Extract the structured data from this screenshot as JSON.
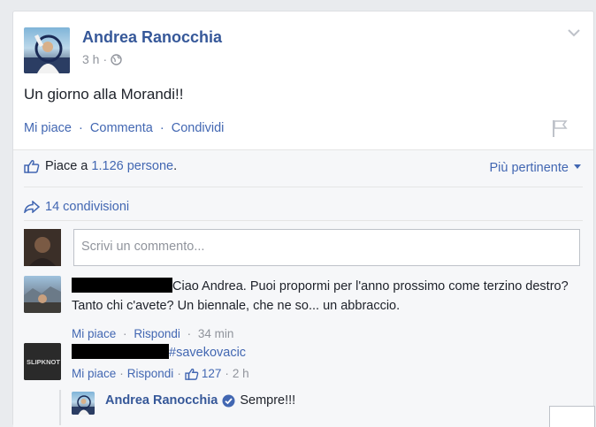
{
  "post": {
    "author": "Andrea Ranocchia",
    "time": "3 h",
    "time_sep": "·",
    "status_text": "Un giorno alla Morandi!!",
    "actions": {
      "like": "Mi piace",
      "comment": "Commenta",
      "share": "Condividi",
      "sep": "·"
    }
  },
  "ufi": {
    "likes_prefix": "Piace a",
    "likes_count": "1.126 persone",
    "likes_suffix": ".",
    "sort_label": "Più pertinente",
    "shares_label": "14 condivisioni",
    "comment_placeholder": "Scrivi un commento...",
    "colors": {
      "link": "#4267b2",
      "name": "#365899",
      "muted": "#90949c",
      "background": "#f6f7f9"
    }
  },
  "comments": [
    {
      "text": "Ciao Andrea. Puoi propormi per l'anno prossimo come terzino destro? Tanto chi c'avete? Un biennale, che ne so... un abbraccio.",
      "like": "Mi piace",
      "reply": "Rispondi",
      "time": "34 min",
      "sep": "·"
    },
    {
      "text": "#savekovacic",
      "like": "Mi piace",
      "reply": "Rispondi",
      "likes": "127",
      "time": "2 h",
      "sep": "·",
      "avatar_text": "SLIPKNOT",
      "reply_item": {
        "author": "Andrea Ranocchia",
        "text": "Sempre!!!"
      }
    }
  ],
  "icons": {
    "options": "chevron-down-icon",
    "privacy": "globe-icon",
    "report": "flag-icon",
    "like": "thumbs-up-icon",
    "share": "share-arrow-icon",
    "verified": "verified-badge-icon"
  }
}
